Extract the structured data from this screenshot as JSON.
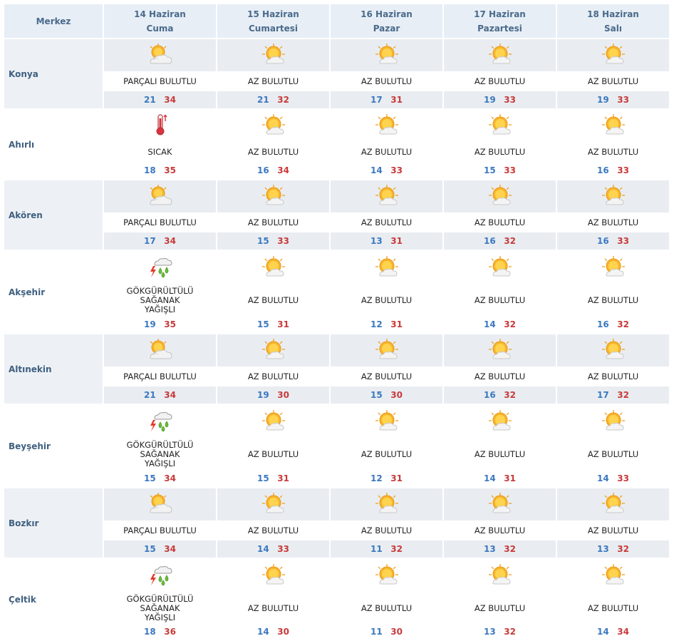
{
  "header": {
    "city_label": "Merkez",
    "days": [
      {
        "date": "14 Haziran",
        "weekday": "Cuma"
      },
      {
        "date": "15 Haziran",
        "weekday": "Cumartesi"
      },
      {
        "date": "16 Haziran",
        "weekday": "Pazar"
      },
      {
        "date": "17 Haziran",
        "weekday": "Pazartesi"
      },
      {
        "date": "18 Haziran",
        "weekday": "Salı"
      }
    ]
  },
  "icons": {
    "az_bulutlu": "sun-cloud-icon",
    "parcali_bulutlu": "partly-cloudy-icon",
    "sicak": "thermometer-icon",
    "gokgurultulu": "thunderstorm-icon"
  },
  "colors": {
    "min": "#3b78c0",
    "max": "#c83a3a",
    "header_bg": "#e7eef6"
  },
  "rows": [
    {
      "name": "Konya",
      "days": [
        {
          "icon": "parcali_bulutlu",
          "desc": "PARÇALI BULUTLU",
          "min": "21",
          "max": "34"
        },
        {
          "icon": "az_bulutlu",
          "desc": "AZ BULUTLU",
          "min": "21",
          "max": "32"
        },
        {
          "icon": "az_bulutlu",
          "desc": "AZ BULUTLU",
          "min": "17",
          "max": "31"
        },
        {
          "icon": "az_bulutlu",
          "desc": "AZ BULUTLU",
          "min": "19",
          "max": "33"
        },
        {
          "icon": "az_bulutlu",
          "desc": "AZ BULUTLU",
          "min": "19",
          "max": "33"
        }
      ]
    },
    {
      "name": "Ahırlı",
      "days": [
        {
          "icon": "sicak",
          "desc": "SICAK",
          "min": "18",
          "max": "35"
        },
        {
          "icon": "az_bulutlu",
          "desc": "AZ BULUTLU",
          "min": "16",
          "max": "34"
        },
        {
          "icon": "az_bulutlu",
          "desc": "AZ BULUTLU",
          "min": "14",
          "max": "33"
        },
        {
          "icon": "az_bulutlu",
          "desc": "AZ BULUTLU",
          "min": "15",
          "max": "33"
        },
        {
          "icon": "az_bulutlu",
          "desc": "AZ BULUTLU",
          "min": "16",
          "max": "33"
        }
      ]
    },
    {
      "name": "Akören",
      "days": [
        {
          "icon": "parcali_bulutlu",
          "desc": "PARÇALI BULUTLU",
          "min": "17",
          "max": "34"
        },
        {
          "icon": "az_bulutlu",
          "desc": "AZ BULUTLU",
          "min": "15",
          "max": "33"
        },
        {
          "icon": "az_bulutlu",
          "desc": "AZ BULUTLU",
          "min": "13",
          "max": "31"
        },
        {
          "icon": "az_bulutlu",
          "desc": "AZ BULUTLU",
          "min": "16",
          "max": "32"
        },
        {
          "icon": "az_bulutlu",
          "desc": "AZ BULUTLU",
          "min": "16",
          "max": "33"
        }
      ]
    },
    {
      "name": "Akşehir",
      "days": [
        {
          "icon": "gokgurultulu",
          "desc": "GÖKGÜRÜLTÜLÜ SAĞANAK YAĞIŞLI",
          "min": "19",
          "max": "35"
        },
        {
          "icon": "az_bulutlu",
          "desc": "AZ BULUTLU",
          "min": "15",
          "max": "31"
        },
        {
          "icon": "az_bulutlu",
          "desc": "AZ BULUTLU",
          "min": "12",
          "max": "31"
        },
        {
          "icon": "az_bulutlu",
          "desc": "AZ BULUTLU",
          "min": "14",
          "max": "32"
        },
        {
          "icon": "az_bulutlu",
          "desc": "AZ BULUTLU",
          "min": "16",
          "max": "32"
        }
      ]
    },
    {
      "name": "Altınekin",
      "days": [
        {
          "icon": "parcali_bulutlu",
          "desc": "PARÇALI BULUTLU",
          "min": "21",
          "max": "34"
        },
        {
          "icon": "az_bulutlu",
          "desc": "AZ BULUTLU",
          "min": "19",
          "max": "30"
        },
        {
          "icon": "az_bulutlu",
          "desc": "AZ BULUTLU",
          "min": "15",
          "max": "30"
        },
        {
          "icon": "az_bulutlu",
          "desc": "AZ BULUTLU",
          "min": "16",
          "max": "32"
        },
        {
          "icon": "az_bulutlu",
          "desc": "AZ BULUTLU",
          "min": "17",
          "max": "32"
        }
      ]
    },
    {
      "name": "Beyşehir",
      "days": [
        {
          "icon": "gokgurultulu",
          "desc": "GÖKGÜRÜLTÜLÜ SAĞANAK YAĞIŞLI",
          "min": "15",
          "max": "34"
        },
        {
          "icon": "az_bulutlu",
          "desc": "AZ BULUTLU",
          "min": "15",
          "max": "31"
        },
        {
          "icon": "az_bulutlu",
          "desc": "AZ BULUTLU",
          "min": "12",
          "max": "31"
        },
        {
          "icon": "az_bulutlu",
          "desc": "AZ BULUTLU",
          "min": "14",
          "max": "31"
        },
        {
          "icon": "az_bulutlu",
          "desc": "AZ BULUTLU",
          "min": "14",
          "max": "33"
        }
      ]
    },
    {
      "name": "Bozkır",
      "days": [
        {
          "icon": "parcali_bulutlu",
          "desc": "PARÇALI BULUTLU",
          "min": "15",
          "max": "34"
        },
        {
          "icon": "az_bulutlu",
          "desc": "AZ BULUTLU",
          "min": "14",
          "max": "33"
        },
        {
          "icon": "az_bulutlu",
          "desc": "AZ BULUTLU",
          "min": "11",
          "max": "32"
        },
        {
          "icon": "az_bulutlu",
          "desc": "AZ BULUTLU",
          "min": "13",
          "max": "32"
        },
        {
          "icon": "az_bulutlu",
          "desc": "AZ BULUTLU",
          "min": "13",
          "max": "32"
        }
      ]
    },
    {
      "name": "Çeltik",
      "days": [
        {
          "icon": "gokgurultulu",
          "desc": "GÖKGÜRÜLTÜLÜ SAĞANAK YAĞIŞLI",
          "min": "18",
          "max": "36"
        },
        {
          "icon": "az_bulutlu",
          "desc": "AZ BULUTLU",
          "min": "14",
          "max": "30"
        },
        {
          "icon": "az_bulutlu",
          "desc": "AZ BULUTLU",
          "min": "11",
          "max": "30"
        },
        {
          "icon": "az_bulutlu",
          "desc": "AZ BULUTLU",
          "min": "13",
          "max": "32"
        },
        {
          "icon": "az_bulutlu",
          "desc": "AZ BULUTLU",
          "min": "14",
          "max": "34"
        }
      ]
    }
  ]
}
